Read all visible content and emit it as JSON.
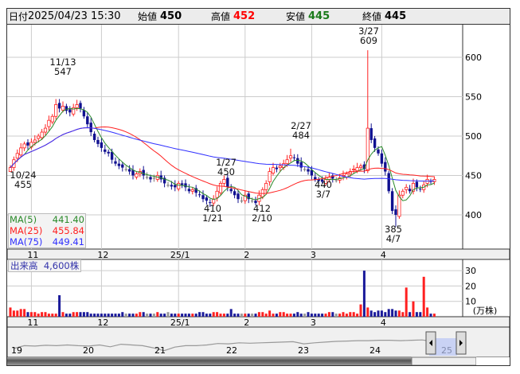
{
  "header": {
    "date_label": "日付",
    "datetime": "2025/04/23 15:30",
    "open_label": "始値",
    "open": "450",
    "high_label": "高値",
    "high": "452",
    "low_label": "安値",
    "low": "445",
    "close_label": "終値",
    "close": "445"
  },
  "legend": [
    {
      "name": "MA(5)",
      "value": "441.40",
      "color": "#2a8a2a"
    },
    {
      "name": "MA(25)",
      "value": "455.84",
      "color": "#ff2020"
    },
    {
      "name": "MA(75)",
      "value": "449.41",
      "color": "#3030ff"
    }
  ],
  "volume_legend": {
    "label": "出来高",
    "value": "4,600株"
  },
  "annotations": [
    {
      "date": "11/13",
      "price": "547"
    },
    {
      "date": "10/24",
      "price": "455"
    },
    {
      "date": "1/21",
      "price": "410"
    },
    {
      "date": "1/27",
      "price": "450"
    },
    {
      "date": "2/10",
      "price": "412"
    },
    {
      "date": "2/27",
      "price": "484"
    },
    {
      "date": "3/7",
      "price": "440"
    },
    {
      "date": "3/27",
      "price": "609"
    },
    {
      "date": "4/7",
      "price": "385"
    }
  ],
  "volume_unit": "(万株)",
  "chart_data": {
    "type": "candlestick",
    "price_axis": {
      "ticks": [
        400,
        450,
        500,
        550,
        600
      ],
      "range": [
        350,
        630
      ]
    },
    "volume_axis": {
      "ticks": [
        10,
        20,
        30
      ],
      "range": [
        0,
        30
      ]
    },
    "month_labels": [
      {
        "label": "11",
        "index": 6
      },
      {
        "label": "12",
        "index": 26
      },
      {
        "label": "25/1",
        "index": 48
      },
      {
        "label": "2",
        "index": 67
      },
      {
        "label": "3",
        "index": 86
      },
      {
        "label": "4",
        "index": 106
      }
    ],
    "close": [
      460,
      470,
      478,
      485,
      490,
      488,
      492,
      495,
      500,
      505,
      510,
      520,
      525,
      540,
      535,
      538,
      532,
      530,
      536,
      540,
      535,
      525,
      515,
      505,
      495,
      490,
      485,
      480,
      478,
      470,
      465,
      462,
      460,
      458,
      455,
      450,
      452,
      455,
      450,
      448,
      445,
      447,
      450,
      445,
      440,
      438,
      436,
      435,
      440,
      438,
      435,
      430,
      432,
      428,
      425,
      420,
      418,
      415,
      420,
      430,
      440,
      445,
      435,
      430,
      425,
      420,
      418,
      425,
      420,
      418,
      415,
      425,
      432,
      440,
      455,
      460,
      458,
      462,
      465,
      470,
      475,
      472,
      465,
      460,
      458,
      455,
      450,
      445,
      443,
      442,
      445,
      448,
      446,
      444,
      447,
      450,
      452,
      455,
      458,
      460,
      462,
      458,
      510,
      495,
      485,
      478,
      465,
      455,
      430,
      405,
      400,
      425,
      430,
      435,
      430,
      440,
      435,
      432,
      438,
      445,
      442,
      445
    ],
    "extremes": [
      {
        "index": 0,
        "low": 455
      },
      {
        "index": 13,
        "high": 547
      },
      {
        "index": 57,
        "low": 410
      },
      {
        "index": 61,
        "high": 450
      },
      {
        "index": 70,
        "low": 412
      },
      {
        "index": 80,
        "high": 484
      },
      {
        "index": 89,
        "low": 440
      },
      {
        "index": 102,
        "high": 609
      },
      {
        "index": 110,
        "low": 385
      }
    ],
    "volume": [
      6,
      4,
      4,
      5,
      5,
      3,
      3,
      3,
      2,
      3,
      3,
      2,
      2,
      2,
      14,
      3,
      2,
      2,
      3,
      3,
      3,
      3,
      3,
      2,
      2,
      2,
      2,
      2,
      2,
      2,
      2,
      2,
      3,
      2,
      2,
      2,
      2,
      3,
      3,
      2,
      2,
      2,
      3,
      2,
      2,
      3,
      2,
      2,
      2,
      2,
      2,
      2,
      2,
      2,
      3,
      3,
      2,
      2,
      3,
      3,
      2,
      2,
      2,
      5,
      2,
      2,
      2,
      2,
      2,
      2,
      2,
      3,
      3,
      2,
      4,
      2,
      2,
      3,
      3,
      2,
      2,
      2,
      3,
      2,
      2,
      3,
      2,
      2,
      2,
      2,
      2,
      3,
      3,
      2,
      2,
      3,
      2,
      3,
      3,
      2,
      8,
      30,
      6,
      4,
      3,
      4,
      4,
      3,
      5,
      5,
      4,
      4,
      3,
      19,
      3,
      10,
      3,
      3,
      26,
      6,
      2,
      2
    ],
    "navigator": {
      "labels": [
        "19",
        "20",
        "21",
        "22",
        "23",
        "24",
        "25"
      ],
      "series": [
        60,
        52,
        53,
        51,
        52,
        50,
        52,
        53,
        50,
        55,
        48,
        50,
        52,
        58,
        66,
        56,
        52,
        52,
        50,
        46,
        47,
        44,
        45,
        44,
        43,
        42,
        41,
        47,
        44,
        42,
        40,
        39,
        38,
        38,
        37,
        37,
        38,
        37,
        36,
        40
      ]
    }
  }
}
